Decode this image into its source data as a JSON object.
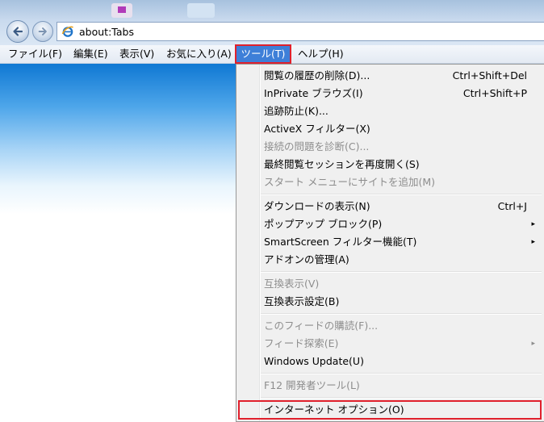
{
  "browser": {
    "address_url": "about:Tabs",
    "icons": {
      "back": "back-arrow-icon",
      "forward": "forward-arrow-icon",
      "page": "ie-page-icon"
    }
  },
  "menubar": {
    "items": [
      {
        "label": "ファイル(F)"
      },
      {
        "label": "編集(E)"
      },
      {
        "label": "表示(V)"
      },
      {
        "label": "お気に入り(A)"
      },
      {
        "label": "ツール(T)",
        "active": true
      },
      {
        "label": "ヘルプ(H)"
      }
    ]
  },
  "tools_menu": {
    "items": [
      {
        "label": "閲覧の履歴の削除(D)...",
        "shortcut": "Ctrl+Shift+Del"
      },
      {
        "label": "InPrivate ブラウズ(I)",
        "shortcut": "Ctrl+Shift+P"
      },
      {
        "label": "追跡防止(K)..."
      },
      {
        "label": "ActiveX フィルター(X)"
      },
      {
        "label": "接続の問題を診断(C)...",
        "disabled": true
      },
      {
        "label": "最終閲覧セッションを再度開く(S)"
      },
      {
        "label": "スタート メニューにサイトを追加(M)",
        "disabled": true
      },
      {
        "label": "ダウンロードの表示(N)",
        "shortcut": "Ctrl+J"
      },
      {
        "label": "ポップアップ ブロック(P)",
        "submenu": true
      },
      {
        "label": "SmartScreen フィルター機能(T)",
        "submenu": true
      },
      {
        "label": "アドオンの管理(A)"
      },
      {
        "label": "互換表示(V)",
        "disabled": true
      },
      {
        "label": "互換表示設定(B)"
      },
      {
        "label": "このフィードの購読(F)...",
        "disabled": true
      },
      {
        "label": "フィード探索(E)",
        "disabled": true,
        "submenu": true
      },
      {
        "label": "Windows Update(U)"
      },
      {
        "label": "F12 開発者ツール(L)",
        "disabled": true
      },
      {
        "label": "インターネット オプション(O)",
        "highlighted": true
      }
    ],
    "submenu_arrow": "▸"
  },
  "colors": {
    "highlight_border": "#e0202c",
    "active_menu_bg": "#3e7fd8",
    "disabled_text": "#8d8d8d"
  }
}
